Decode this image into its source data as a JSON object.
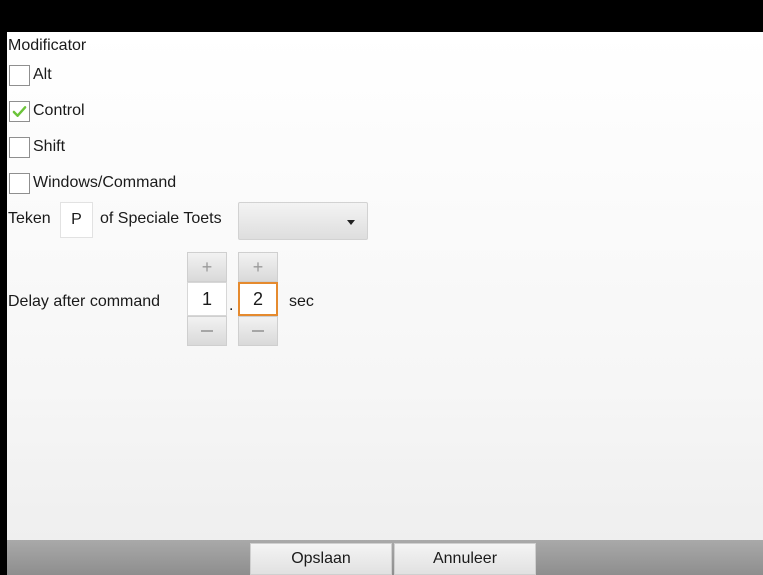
{
  "section_title": "Modificator",
  "modifiers": [
    {
      "label": "Alt",
      "checked": false
    },
    {
      "label": "Control",
      "checked": true
    },
    {
      "label": "Shift",
      "checked": false
    },
    {
      "label": "Windows/Command",
      "checked": false
    }
  ],
  "key": {
    "label": "Teken",
    "value": "P",
    "special_label": "of Speciale Toets",
    "special_value": ""
  },
  "delay": {
    "label": "Delay after command",
    "seconds": "1",
    "separator": ".",
    "tenths": "2",
    "unit": "sec",
    "plus": "+"
  },
  "actions": {
    "save": "Opslaan",
    "cancel": "Annuleer"
  },
  "colors": {
    "check": "#6cc43a",
    "focus": "#e58a2e"
  }
}
